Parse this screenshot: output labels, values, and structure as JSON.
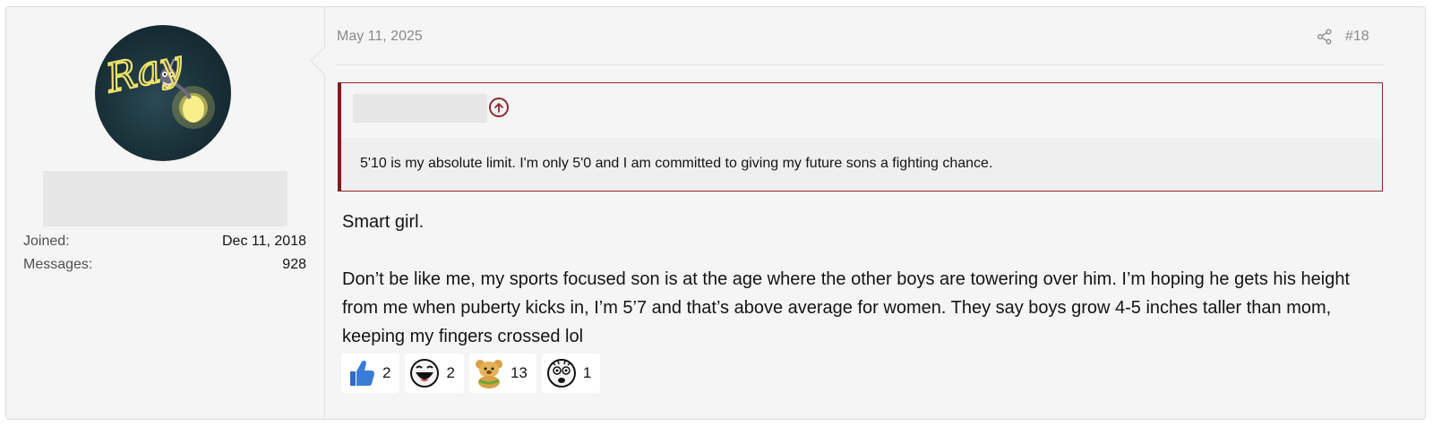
{
  "user": {
    "avatar_text": "Ray",
    "stats": [
      {
        "label": "Joined:",
        "value": "Dec 11, 2018"
      },
      {
        "label": "Messages:",
        "value": "928"
      }
    ]
  },
  "post": {
    "date": "May 11, 2025",
    "number": "#18",
    "quote": {
      "text": "5'10 is my absolute limit. I'm only 5'0 and I am committed to giving my future sons a fighting chance."
    },
    "message": {
      "p1": "Smart girl.",
      "p2": "Don’t be like me, my sports focused son is at the age where the other boys are towering over him. I’m hoping he gets his height from me when puberty kicks in, I’m 5’7 and that’s above average for women. They say boys grow 4-5 inches taller than mom, keeping my fingers crossed lol"
    },
    "reactions": [
      {
        "icon": "thumbs-up-icon",
        "count": "2"
      },
      {
        "icon": "laughing-face-icon",
        "count": "2"
      },
      {
        "icon": "teddy-bear-icon",
        "count": "13"
      },
      {
        "icon": "shocked-face-icon",
        "count": "1"
      }
    ]
  },
  "colors": {
    "quote_accent": "#7a1f1f",
    "thumb_blue": "#3b7bd8"
  }
}
